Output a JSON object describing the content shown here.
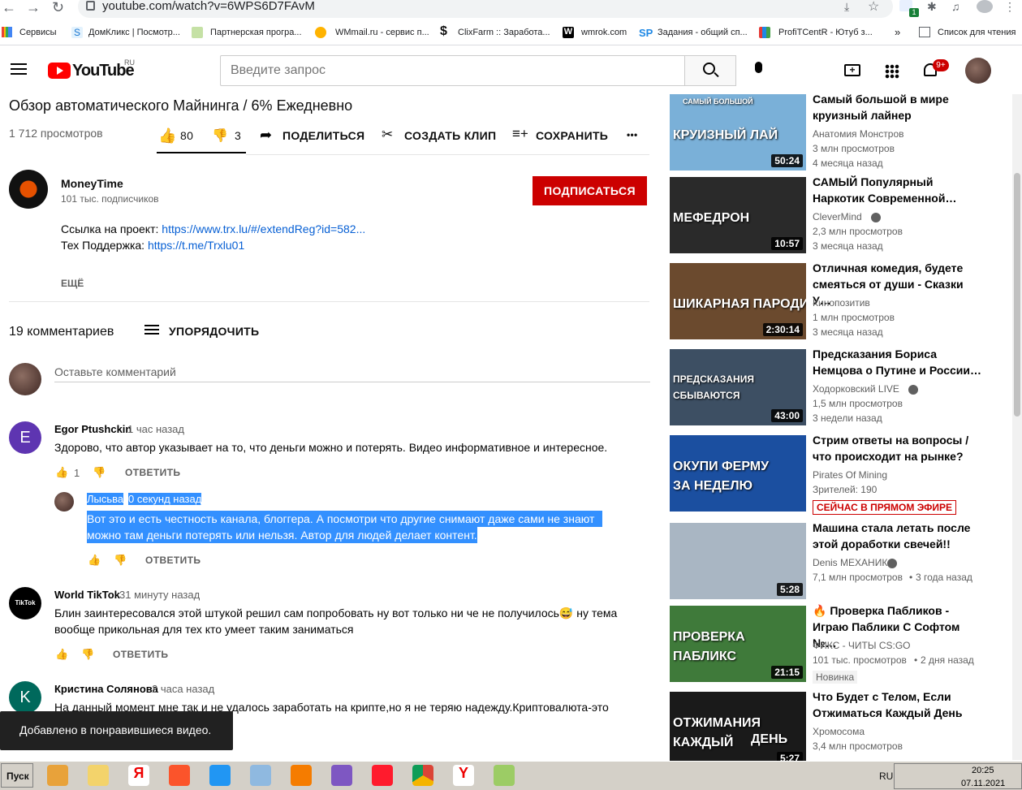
{
  "browser": {
    "url": "youtube.com/watch?v=6WPS6D7FAvM",
    "bookmarks": [
      "Сервисы",
      "ДомКликс | Посмотр...",
      "Партнерская програ...",
      "WMmail.ru - сервис п...",
      "ClixFarm :: Заработа...",
      "wmrok.com",
      "Задания - общий сп...",
      "ProfiTCentR - Ютуб з..."
    ],
    "more": "»",
    "reading_list": "Список для чтения",
    "ext_badge": "1"
  },
  "masthead": {
    "logo": "YouTube",
    "region": "RU",
    "search_placeholder": "Введите запрос",
    "notif_count": "9+"
  },
  "video": {
    "title": "Обзор автоматического Майнинга / 6% Ежедневно",
    "views": "1 712 просмотров",
    "likes": "80",
    "dislikes": "3",
    "share": "ПОДЕЛИТЬСЯ",
    "clip": "СОЗДАТЬ КЛИП",
    "save": "СОХРАНИТЬ",
    "more": "•••"
  },
  "channel": {
    "name": "MoneyTime",
    "subs": "101 тыс. подписчиков",
    "subscribe": "ПОДПИСАТЬСЯ",
    "desc_line1_label": "Ссылка на проект: ",
    "desc_line1_link": "https://www.trx.lu/#/extendReg?id=582...",
    "desc_line2_label": "Тех Поддержка: ",
    "desc_line2_link": "https://t.me/Trxlu01",
    "more": "ЕЩЁ"
  },
  "comments": {
    "count": "19 комментариев",
    "sort": "УПОРЯДОЧИТЬ",
    "add_placeholder": "Оставьте комментарий",
    "reply_label": "ОТВЕТИТЬ",
    "items": [
      {
        "initial": "E",
        "author": "Egor Ptushckin",
        "time": "1 час назад",
        "text": "Здорово, что автор указывает на то, что деньги можно и потерять. Видео информативное и интересное.",
        "likes": "1",
        "color": "#5e35b1"
      },
      {
        "author": "Лысьва",
        "time": "0 секунд назад",
        "text1": "Вот это и есть честность канала, блоггера. А посмотри что другие снимают даже сами не знают",
        "text2": "можно там деньги потерять или нельзя. Автор для людей делает контент."
      },
      {
        "author": "World TikTok",
        "time": "31 минуту назад",
        "text1": "Блин заинтересовался этой штукой решил сам попробовать ну вот только ни че не получилось😅 ну тема",
        "text2": "вообще прикольная для тех кто умеет таким заниматься",
        "avatar_text": "TikTok"
      },
      {
        "initial": "K",
        "author": "Кристина Солянова",
        "time": "2 часа назад",
        "text": "На данный момент мне так и не удалось заработать на крипте,но я не теряю надежду.Криптовалюта-это",
        "color": "#00695c"
      }
    ]
  },
  "sidebar": [
    {
      "title1": "Самый большой в мире",
      "title2": "круизный лайнер",
      "channel": "Анатомия Монстров",
      "meta1": "3 млн просмотров",
      "meta2": "4 месяца назад",
      "duration": "50:24",
      "thumb_text": "КРУИЗНЫЙ ЛАЙ",
      "thumb_top": "САМЫЙ БОЛЬШОЙ",
      "bg": "#7ab0d8",
      "verified": false
    },
    {
      "title1": "САМЫЙ Популярный",
      "title2": "Наркотик Современной…",
      "channel": "CleverMind",
      "meta1": "2,3 млн просмотров",
      "meta2": "3 месяца назад",
      "duration": "10:57",
      "thumb_text": "МЕФЕДРОН",
      "bg": "#2a2a2a",
      "verified": true
    },
    {
      "title1": "Отличная комедия, будете",
      "title2": "смеяться от души - Сказки У…",
      "channel": "Кинопозитив",
      "meta1": "1 млн просмотров",
      "meta2": "3 месяца назад",
      "duration": "2:30:14",
      "thumb_text": "ШИКАРНАЯ ПАРОДИЯ",
      "bg": "#6b4a2e",
      "verified": false
    },
    {
      "title1": "Предсказания Бориса",
      "title2": "Немцова о Путине и России…",
      "channel": "Ходорковский LIVE",
      "meta1": "1,5 млн просмотров",
      "meta2": "3 недели назад",
      "duration": "43:00",
      "thumb_text": "ПРЕДСКАЗАНИЯ",
      "thumb_text2": "СБЫВАЮТСЯ",
      "bg": "#3d4f63",
      "verified": true
    },
    {
      "title1": "Стрим ответы на вопросы /",
      "title2": "что происходит на рынке?",
      "channel": "Pirates Of Mining",
      "meta1": "Зрителей: 190",
      "live": "СЕЙЧАС В ПРЯМОМ ЭФИРЕ",
      "thumb_text": "ОКУПИ ФЕРМУ",
      "thumb_text2": "ЗА НЕДЕЛЮ",
      "bg": "#1b4fa0",
      "verified": false
    },
    {
      "title1": "Машина стала летать после",
      "title2": "этой доработки свечей!!",
      "channel": "Denis МЕХАНИК",
      "meta1": "7,1 млн просмотров",
      "meta2": "3 года назад",
      "duration": "5:28",
      "bg": "#a9b6c3",
      "verified": true
    },
    {
      "title1": "🔥 Проверка Пабликов -",
      "title2": "Играю Паблики С Софтом №…",
      "channel": "ФИКС - ЧИТЫ CS:GO",
      "meta1": "101 тыс. просмотров",
      "meta2": "2 дня назад",
      "badge": "Новинка",
      "duration": "21:15",
      "thumb_text": "ПРОВЕРКА",
      "thumb_text2": "ПАБЛИКС",
      "bg": "#3f7a3a",
      "verified": false
    },
    {
      "title1": "Что Будет с Телом, Если",
      "title2": "Отжиматься Каждый День",
      "channel": "Хромосома",
      "meta1": "3,4 млн просмотров",
      "duration": "5:27",
      "thumb_text": "ОТЖИМАНИЯ",
      "thumb_text2": "КАЖДЫЙ",
      "thumb_text3": "ДЕНЬ",
      "bg": "#1a1a1a",
      "verified": false
    }
  ],
  "toast": "Добавлено в понравившиеся видео.",
  "taskbar": {
    "start": "Пуск",
    "lang": "RU",
    "time": "20:25",
    "date": "07.11.2021"
  }
}
